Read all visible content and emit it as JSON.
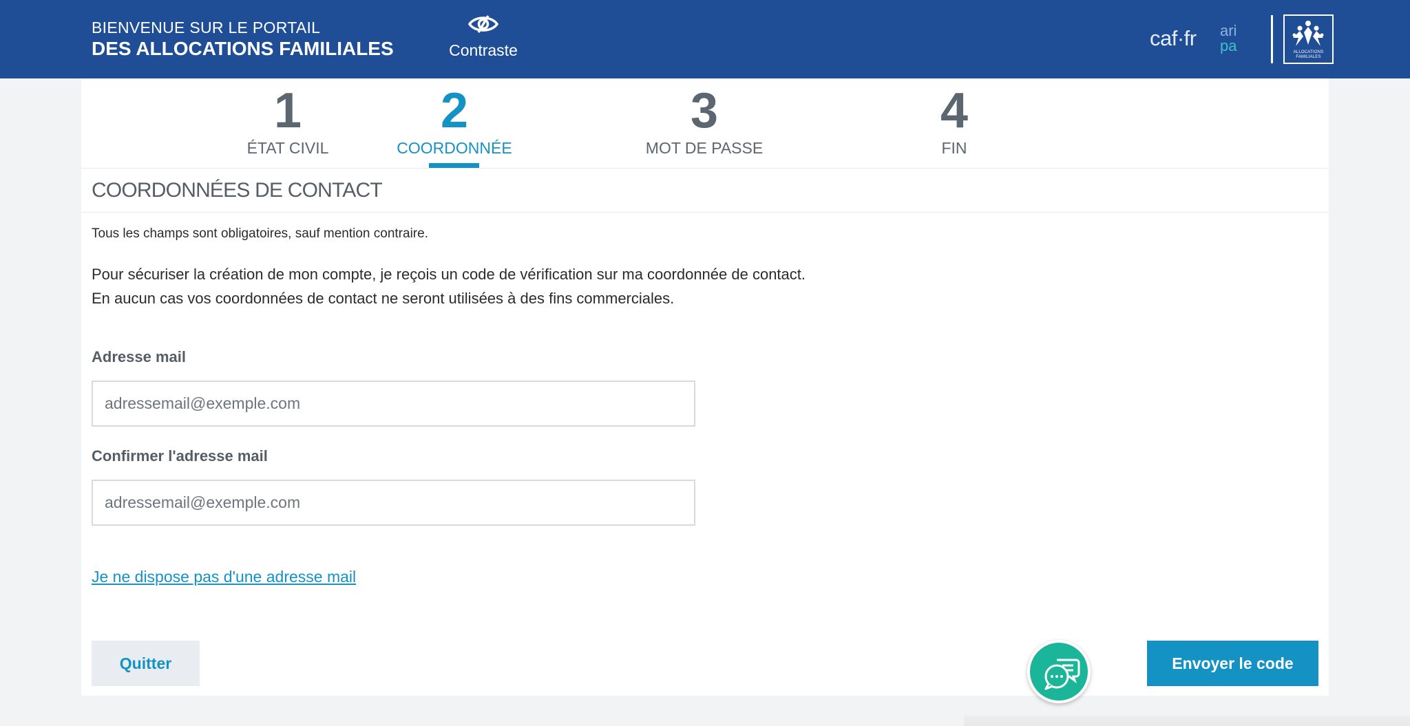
{
  "header": {
    "brand_line1": "BIENVENUE SUR LE PORTAIL",
    "brand_line2": "DES ALLOCATIONS FAMILIALES",
    "contrast_label": "Contraste",
    "contrast_icon": "eye-icon",
    "logo_caf": "caf·fr",
    "logo_aripa_top": "ari",
    "logo_aripa_bottom": "pa",
    "logo_badge_text": "ALLOCATIONS FAMILIALES"
  },
  "steps": [
    {
      "number": "1",
      "label": "ÉTAT CIVIL",
      "active": false
    },
    {
      "number": "2",
      "label": "COORDONNÉE",
      "active": true
    },
    {
      "number": "3",
      "label": "MOT DE PASSE",
      "active": false
    },
    {
      "number": "4",
      "label": "FIN",
      "active": false
    }
  ],
  "section": {
    "title": "COORDONNÉES DE CONTACT",
    "note": "Tous les champs sont obligatoires, sauf mention contraire.",
    "info_line1": "Pour sécuriser la création de mon compte, je reçois un code de vérification sur ma coordonnée de contact.",
    "info_line2": "En aucun cas vos coordonnées de contact ne seront utilisées à des fins commerciales."
  },
  "form": {
    "email_label": "Adresse mail",
    "email_placeholder": "adressemail@exemple.com",
    "email_value": "",
    "confirm_label": "Confirmer l'adresse mail",
    "confirm_placeholder": "adressemail@exemple.com",
    "confirm_value": "",
    "no_mail_link": "Je ne dispose pas d'une adresse mail"
  },
  "actions": {
    "quit_label": "Quitter",
    "send_label": "Envoyer le code",
    "chat_icon": "chat-bubbles-icon"
  },
  "colors": {
    "header_bg": "#1f4e97",
    "accent": "#1592c4",
    "chat_bg": "#1bb59a"
  }
}
